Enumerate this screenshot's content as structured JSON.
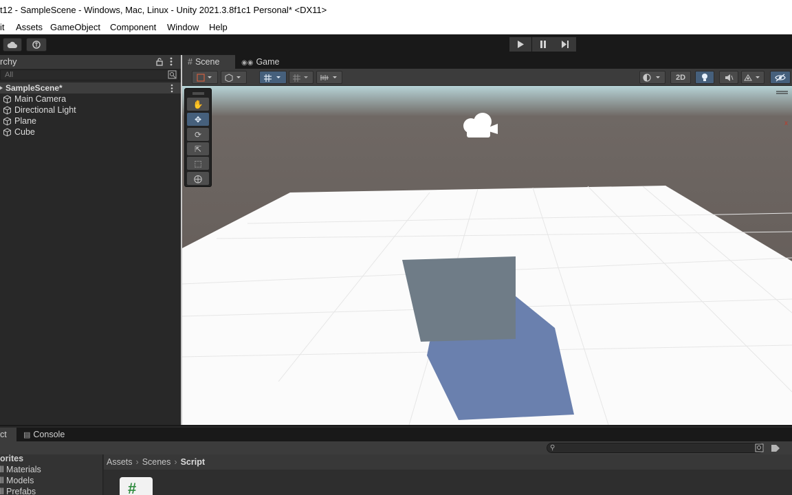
{
  "window": {
    "title": "t12 - SampleScene - Windows, Mac, Linux - Unity 2021.3.8f1c1 Personal* <DX11>"
  },
  "menu": [
    "it",
    "Assets",
    "GameObject",
    "Component",
    "Window",
    "Help"
  ],
  "toolbar": {
    "play_icon": "play-icon",
    "pause_icon": "pause-icon",
    "step_icon": "step-icon"
  },
  "hierarchy": {
    "title": "rchy",
    "search_placeholder": "All",
    "scene_name": "SampleScene*",
    "items": [
      "Main Camera",
      "Directional Light",
      "Plane",
      "Cube"
    ]
  },
  "scene_view": {
    "tabs": [
      "Scene",
      "Game"
    ],
    "mode_2d_label": "2D",
    "axis_label": "x"
  },
  "bottom": {
    "tabs": [
      "ct",
      "Console"
    ],
    "favorites_title": "orites",
    "favorites": [
      "ll Materials",
      "ll Models",
      "ll Prefabs"
    ],
    "breadcrumb": [
      "Assets",
      "Scenes",
      "Script"
    ],
    "script_glyph": "#"
  },
  "colors": {
    "accent_blue": "#46607c",
    "panel_dark": "#282828",
    "cube_color": "#6f7c87",
    "shadow_color": "#6a80ae"
  }
}
